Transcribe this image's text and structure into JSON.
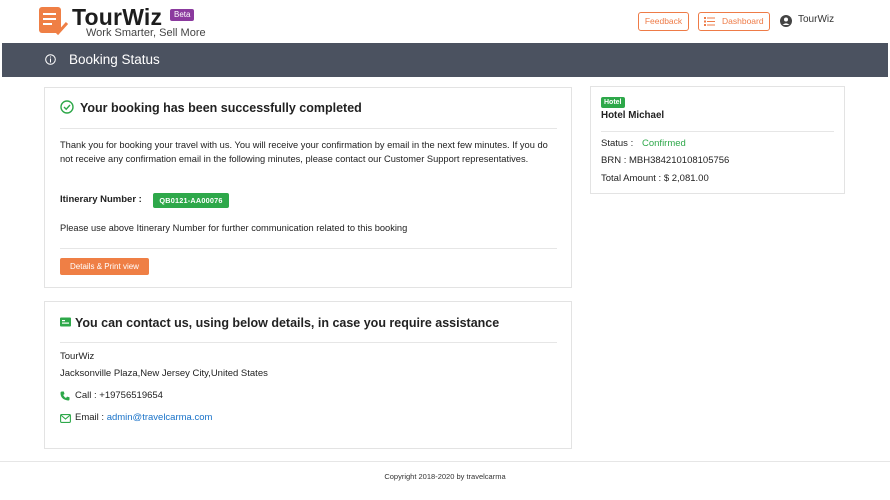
{
  "header": {
    "brand": "TourWiz",
    "beta": "Beta",
    "tagline": "Work Smarter, Sell More",
    "feedback_label": "Feedback",
    "dashboard_label": "Dashboard",
    "user_name": "TourWiz"
  },
  "titlebar": {
    "title": "Booking Status"
  },
  "success": {
    "title": "Your booking has been successfully completed",
    "message": "Thank you for booking your travel with us. You will receive your confirmation by email in the next few minutes. If you do not receive any confirmation email in the following minutes, please contact our Customer Support representatives.",
    "itinerary_label": "Itinerary Number :",
    "itinerary_number": "QB0121-AA00076",
    "itinerary_note": "Please use above Itinerary Number for further communication related to this booking",
    "print_button": "Details & Print view"
  },
  "contact": {
    "title": "You can contact us, using below details, in case you require assistance",
    "company": "TourWiz",
    "address": "Jacksonville Plaza,New Jersey City,United States",
    "phone_label": "Call : +19756519654",
    "email_label": "Email : ",
    "email": "admin@travelcarma.com"
  },
  "hotel": {
    "badge": "Hotel",
    "name": "Hotel Michael",
    "status_label": "Status :",
    "status_value": "Confirmed",
    "brn": "BRN : MBH384210108105756",
    "total": "Total Amount : $ 2,081.00"
  },
  "footer": {
    "copyright": "Copyright 2018-2020 by travelcarma"
  },
  "colors": {
    "accent": "#ef7f45",
    "success": "#2ea84a",
    "titlebar": "#4b5260",
    "link": "#1a73c9",
    "beta": "#8b3a9e"
  }
}
